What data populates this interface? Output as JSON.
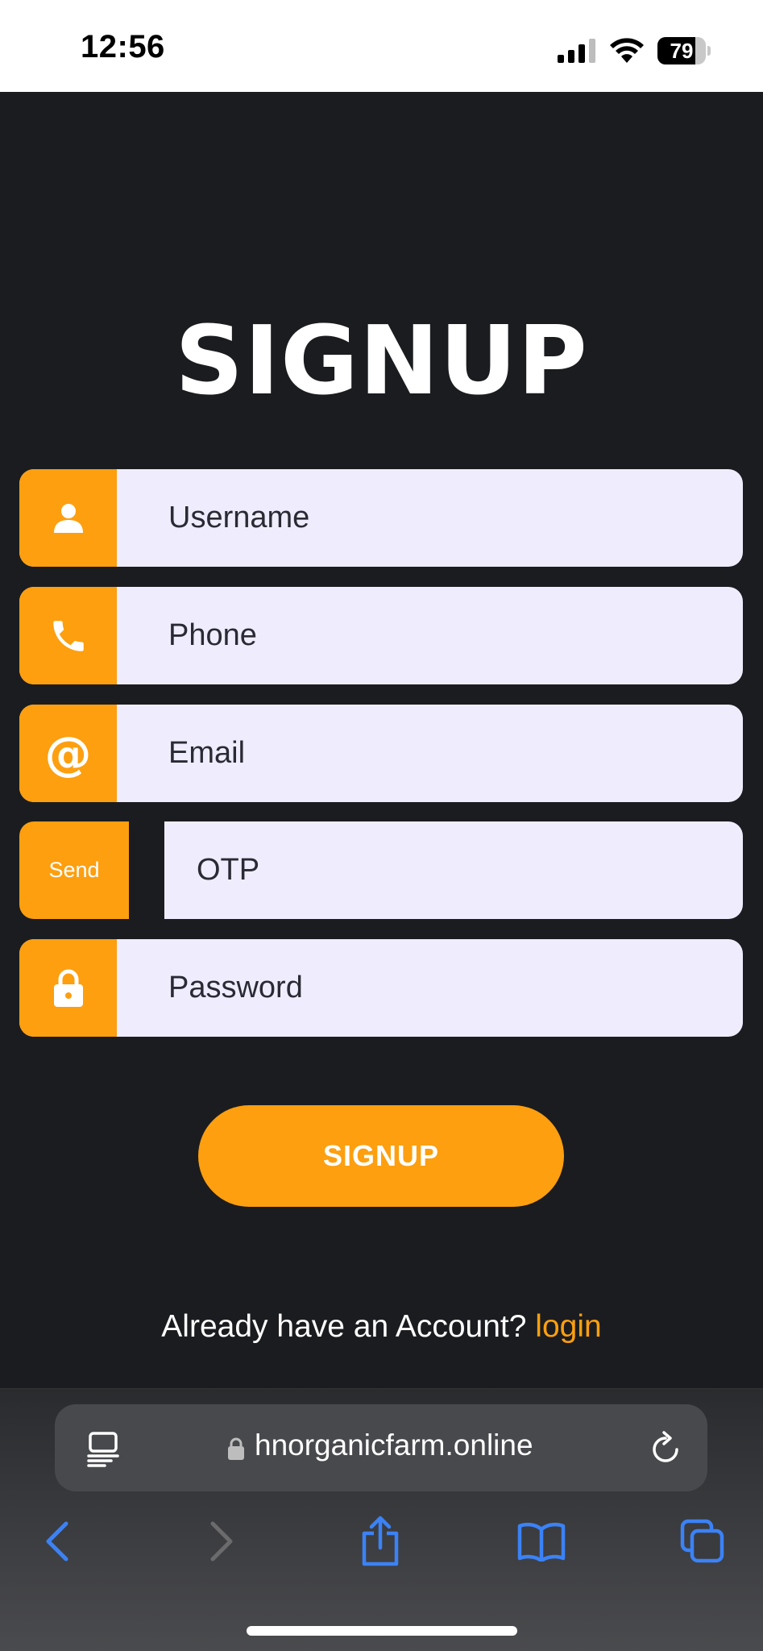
{
  "status": {
    "time": "12:56",
    "battery": "79",
    "battery_level": 0.79
  },
  "page": {
    "title": "SIGNUP"
  },
  "form": {
    "username_placeholder": "Username",
    "phone_placeholder": "Phone",
    "email_placeholder": "Email",
    "send_label": "Send",
    "otp_placeholder": "OTP",
    "password_placeholder": "Password",
    "submit_label": "SIGNUP"
  },
  "footer": {
    "prompt": "Already have an Account? ",
    "login_label": "login"
  },
  "browser": {
    "url": "hnorganicfarm.online"
  },
  "colors": {
    "accent": "#fd9f0f",
    "background": "#1b1c20",
    "field": "#efedfd",
    "toolbar_icon": "#3b82f6"
  },
  "icons": [
    "user-icon",
    "phone-icon",
    "at-icon",
    "lock-icon",
    "reader-icon",
    "reload-icon",
    "back-icon",
    "forward-icon",
    "share-icon",
    "bookmarks-icon",
    "tabs-icon"
  ]
}
